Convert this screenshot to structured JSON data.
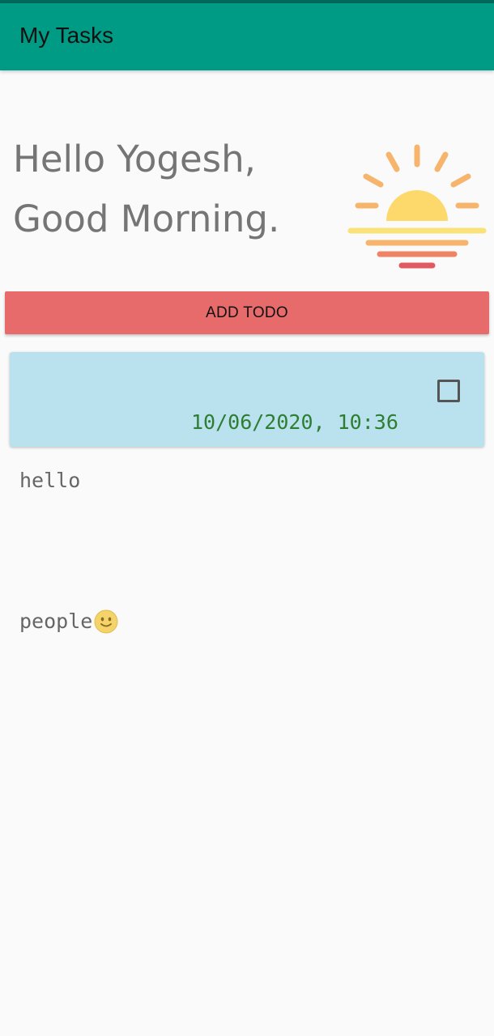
{
  "app_bar": {
    "title": "My Tasks",
    "color": "#009b85"
  },
  "greeting": {
    "line1": "Hello Yogesh,",
    "line2": "Good Morning.",
    "icon": "sunrise-icon"
  },
  "actions": {
    "add_label": "ADD TODO",
    "add_color": "#e76b6b"
  },
  "todos": [
    {
      "line1": "hello",
      "line2": "people",
      "emoji_icon": "slightly-smiling-face-icon",
      "datetime": "10/06/2020, 10:36",
      "checked": false,
      "card_color": "#b9e2ee"
    }
  ]
}
